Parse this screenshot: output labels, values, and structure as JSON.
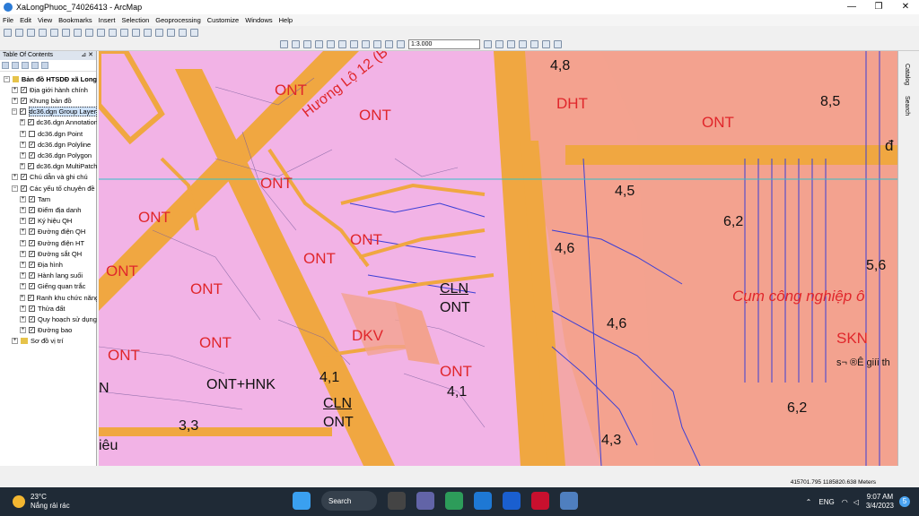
{
  "window": {
    "title": "XaLongPhuoc_74026413 - ArcMap",
    "minimize": "—",
    "maximize": "❐",
    "close": "✕"
  },
  "menu": [
    "File",
    "Edit",
    "View",
    "Bookmarks",
    "Insert",
    "Selection",
    "Geoprocessing",
    "Customize",
    "Windows",
    "Help"
  ],
  "toolbar": {
    "scale": "1:3.000"
  },
  "toc": {
    "title": "Table Of Contents",
    "pin": "⊿ ✕",
    "items": [
      {
        "label": "Bản đồ HTSDĐ xã Long",
        "level": 0,
        "expand": "−",
        "checked": null
      },
      {
        "label": "Địa giới hành chính",
        "level": 1,
        "expand": "+",
        "checked": true
      },
      {
        "label": "Khung bản đồ",
        "level": 1,
        "expand": "+",
        "checked": true
      },
      {
        "label": "dc36.dgn Group Layer",
        "level": 1,
        "expand": "−",
        "checked": true,
        "selected": true
      },
      {
        "label": "dc36.dgn Annotation",
        "level": 2,
        "expand": "+",
        "checked": true
      },
      {
        "label": "dc36.dgn Point",
        "level": 2,
        "expand": "+",
        "checked": false
      },
      {
        "label": "dc36.dgn Polyline",
        "level": 2,
        "expand": "+",
        "checked": true
      },
      {
        "label": "dc36.dgn Polygon",
        "level": 2,
        "expand": "+",
        "checked": true
      },
      {
        "label": "dc36.dgn MultiPatch",
        "level": 2,
        "expand": "+",
        "checked": true
      },
      {
        "label": "Chú dẫn và ghi chú",
        "level": 1,
        "expand": "+",
        "checked": true
      },
      {
        "label": "Các yếu tố chuyên đề",
        "level": 1,
        "expand": "−",
        "checked": true
      },
      {
        "label": "Tam",
        "level": 2,
        "expand": "+",
        "checked": true
      },
      {
        "label": "Điểm địa danh",
        "level": 2,
        "expand": "+",
        "checked": true
      },
      {
        "label": "Ký hiệu QH",
        "level": 2,
        "expand": "+",
        "checked": true
      },
      {
        "label": "Đường điện QH",
        "level": 2,
        "expand": "+",
        "checked": true
      },
      {
        "label": "Đường điện HT",
        "level": 2,
        "expand": "+",
        "checked": true
      },
      {
        "label": "Đường sắt QH",
        "level": 2,
        "expand": "+",
        "checked": true
      },
      {
        "label": "Địa hình",
        "level": 2,
        "expand": "+",
        "checked": true
      },
      {
        "label": "Hành lang suối",
        "level": 2,
        "expand": "+",
        "checked": true
      },
      {
        "label": "Giếng quan trắc",
        "level": 2,
        "expand": "+",
        "checked": true
      },
      {
        "label": "Ranh khu chức năng",
        "level": 2,
        "expand": "+",
        "checked": true
      },
      {
        "label": "Thửa đất",
        "level": 2,
        "expand": "+",
        "checked": true
      },
      {
        "label": "Quy hoạch sử dụng",
        "level": 2,
        "expand": "+",
        "checked": true
      },
      {
        "label": "Đường bao",
        "level": 2,
        "expand": "+",
        "checked": true
      },
      {
        "label": "Sơ đồ vị trí",
        "level": 1,
        "expand": "+",
        "checked": null
      }
    ]
  },
  "map": {
    "labels_red": [
      "ONT",
      "ONT",
      "DHT",
      "ONT",
      "ONT",
      "ONT",
      "ONT",
      "ONT",
      "ONT",
      "ONT",
      "DKV",
      "ONT",
      "ONT",
      "SKN",
      "Cụm công nghiệp ô"
    ],
    "road_name": "Hương Lộ 12 (B",
    "labels_black": [
      "CLN",
      "ONT",
      "ONT+HNK",
      "CLN",
      "ONT",
      "N",
      "iêu"
    ],
    "elevations": [
      "4,8",
      "8,5",
      "4,5",
      "6,2",
      "4,6",
      "5,6",
      "4,6",
      "4,1",
      "4,1",
      "3,3",
      "4,3",
      "6,2"
    ],
    "misc": [
      "đ",
      "s¬ ®Ê giíi th"
    ],
    "colors": {
      "residential": "#f2b3e6",
      "industrial": "#f3a28f",
      "road": "#f0a741",
      "parcel_line": "#3b3fd6"
    }
  },
  "right_tabs": [
    "Catalog",
    "Search"
  ],
  "status": {
    "coords": "415701.795  1185820.638 Meters"
  },
  "taskbar": {
    "temp": "23°C",
    "weather": "Nắng rải rác",
    "search": "Search",
    "lang": "ENG",
    "time": "9:07 AM",
    "date": "3/4/2023",
    "badge": "5"
  }
}
